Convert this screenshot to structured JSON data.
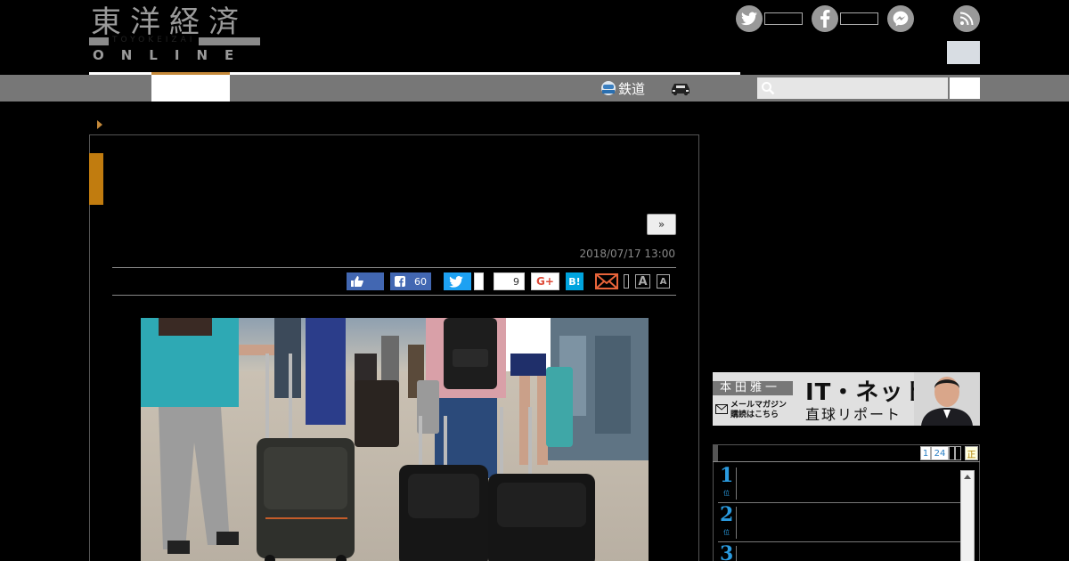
{
  "header": {
    "logo_kanji": "東洋経済",
    "logo_sub": "TOYOKEIZAI",
    "logo_online": "ONLINE"
  },
  "nav": {
    "rail_label": "鉄道"
  },
  "search": {
    "placeholder": ""
  },
  "article": {
    "next_label": "»",
    "date": "2018/07/17 13:00",
    "share": {
      "facebook_count": "60",
      "pocket_count": "9",
      "google_plus_label": "G+",
      "hatena_label": "B!",
      "font_large_label": "A",
      "font_small_label": "A"
    }
  },
  "banner": {
    "author": "本田雅一",
    "mail_line1": "メールマガジン",
    "mail_line2": "購読はこちら",
    "title": "IT・ネット",
    "subtitle": "直球リポート"
  },
  "ranking": {
    "tabs": [
      "1",
      "24",
      "",
      "",
      "正"
    ],
    "items": [
      {
        "rank": "1",
        "suffix": "位"
      },
      {
        "rank": "2",
        "suffix": "位"
      },
      {
        "rank": "3",
        "suffix": "位"
      }
    ]
  },
  "colors": {
    "accent": "#c5893a",
    "facebook": "#4267b2",
    "twitter": "#1da1f2",
    "hatena": "#00a4de",
    "rank_blue": "#2a9be0"
  }
}
